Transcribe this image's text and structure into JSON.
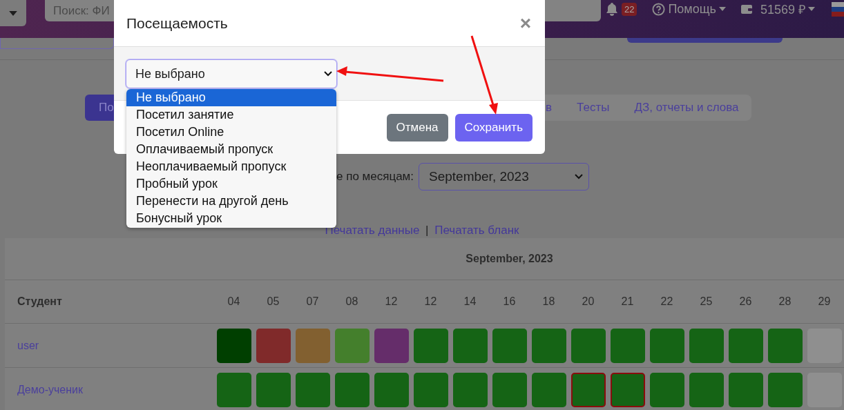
{
  "header": {
    "search": {
      "placeholder": "Поиск: ФИ"
    },
    "notifications": "22",
    "help": "Помощь",
    "balance": "51569 ₽"
  },
  "nav": {
    "button": "По",
    "tabs": [
      {
        "label": "в"
      },
      {
        "label": "Тесты"
      },
      {
        "label": "ДЗ, отчеты и слова"
      }
    ]
  },
  "page": {
    "filter_label": "е по месяцам:",
    "month_select": {
      "value": "September, 2023"
    },
    "links": [
      "Печатать данные",
      "Печатать бланк"
    ],
    "separator": "|"
  },
  "table": {
    "month": "September, 2023",
    "student_header": "Студент",
    "dates": [
      "04",
      "05",
      "07",
      "08",
      "12",
      "12",
      "14",
      "16",
      "18",
      "20",
      "21",
      "22",
      "25",
      "26",
      "28",
      "29"
    ],
    "rows": [
      {
        "name": "user",
        "cells": [
          {
            "color": "#003f00",
            "marked": false
          },
          {
            "color": "#802a2a",
            "marked": false
          },
          {
            "color": "#826030",
            "marked": false
          },
          {
            "color": "#447f2c",
            "marked": false
          },
          {
            "color": "#652d6a",
            "marked": false
          },
          {
            "color": "#156415",
            "marked": false
          },
          {
            "color": "#156415",
            "marked": false
          },
          {
            "color": "#156415",
            "marked": false
          },
          {
            "color": "#156415",
            "marked": false
          },
          {
            "color": "#156415",
            "marked": false
          },
          {
            "color": "#156415",
            "marked": false
          },
          {
            "color": "#156415",
            "marked": false
          },
          {
            "color": "#156415",
            "marked": false
          },
          {
            "color": "#156415",
            "marked": false
          },
          {
            "color": "#156415",
            "marked": false
          },
          {
            "color": "#8f8f8f",
            "marked": false
          }
        ]
      },
      {
        "name": "Демо-ученик",
        "cells": [
          {
            "color": "#156415",
            "marked": false
          },
          {
            "color": "#156415",
            "marked": false
          },
          {
            "color": "#156415",
            "marked": false
          },
          {
            "color": "#156415",
            "marked": false
          },
          {
            "color": "#156415",
            "marked": false
          },
          {
            "color": "#156415",
            "marked": false
          },
          {
            "color": "#156415",
            "marked": false
          },
          {
            "color": "#156415",
            "marked": false
          },
          {
            "color": "#156415",
            "marked": false
          },
          {
            "color": "#156415",
            "marked": true
          },
          {
            "color": "#156415",
            "marked": true
          },
          {
            "color": "#156415",
            "marked": false
          },
          {
            "color": "#156415",
            "marked": false
          },
          {
            "color": "#156415",
            "marked": false
          },
          {
            "color": "#156415",
            "marked": false
          },
          {
            "color": "#8f8f8f",
            "marked": false
          }
        ]
      }
    ]
  },
  "modal": {
    "title": "Посещаемость",
    "close": "×",
    "select": {
      "value": "Не выбрано",
      "expanded": true
    },
    "options": [
      {
        "label": "Не выбрано",
        "selected": true
      },
      {
        "label": "Посетил занятие",
        "selected": false
      },
      {
        "label": "Посетил Online",
        "selected": false
      },
      {
        "label": "Оплачиваемый пропуск",
        "selected": false
      },
      {
        "label": "Неоплачиваемый пропуск",
        "selected": false
      },
      {
        "label": "Пробный урок",
        "selected": false
      },
      {
        "label": "Перенести на другой день",
        "selected": false
      },
      {
        "label": "Бонусный урок",
        "selected": false
      }
    ],
    "buttons": [
      {
        "label": "Отмена",
        "kind": "secondary"
      },
      {
        "label": "Сохранить",
        "kind": "primary"
      }
    ]
  }
}
